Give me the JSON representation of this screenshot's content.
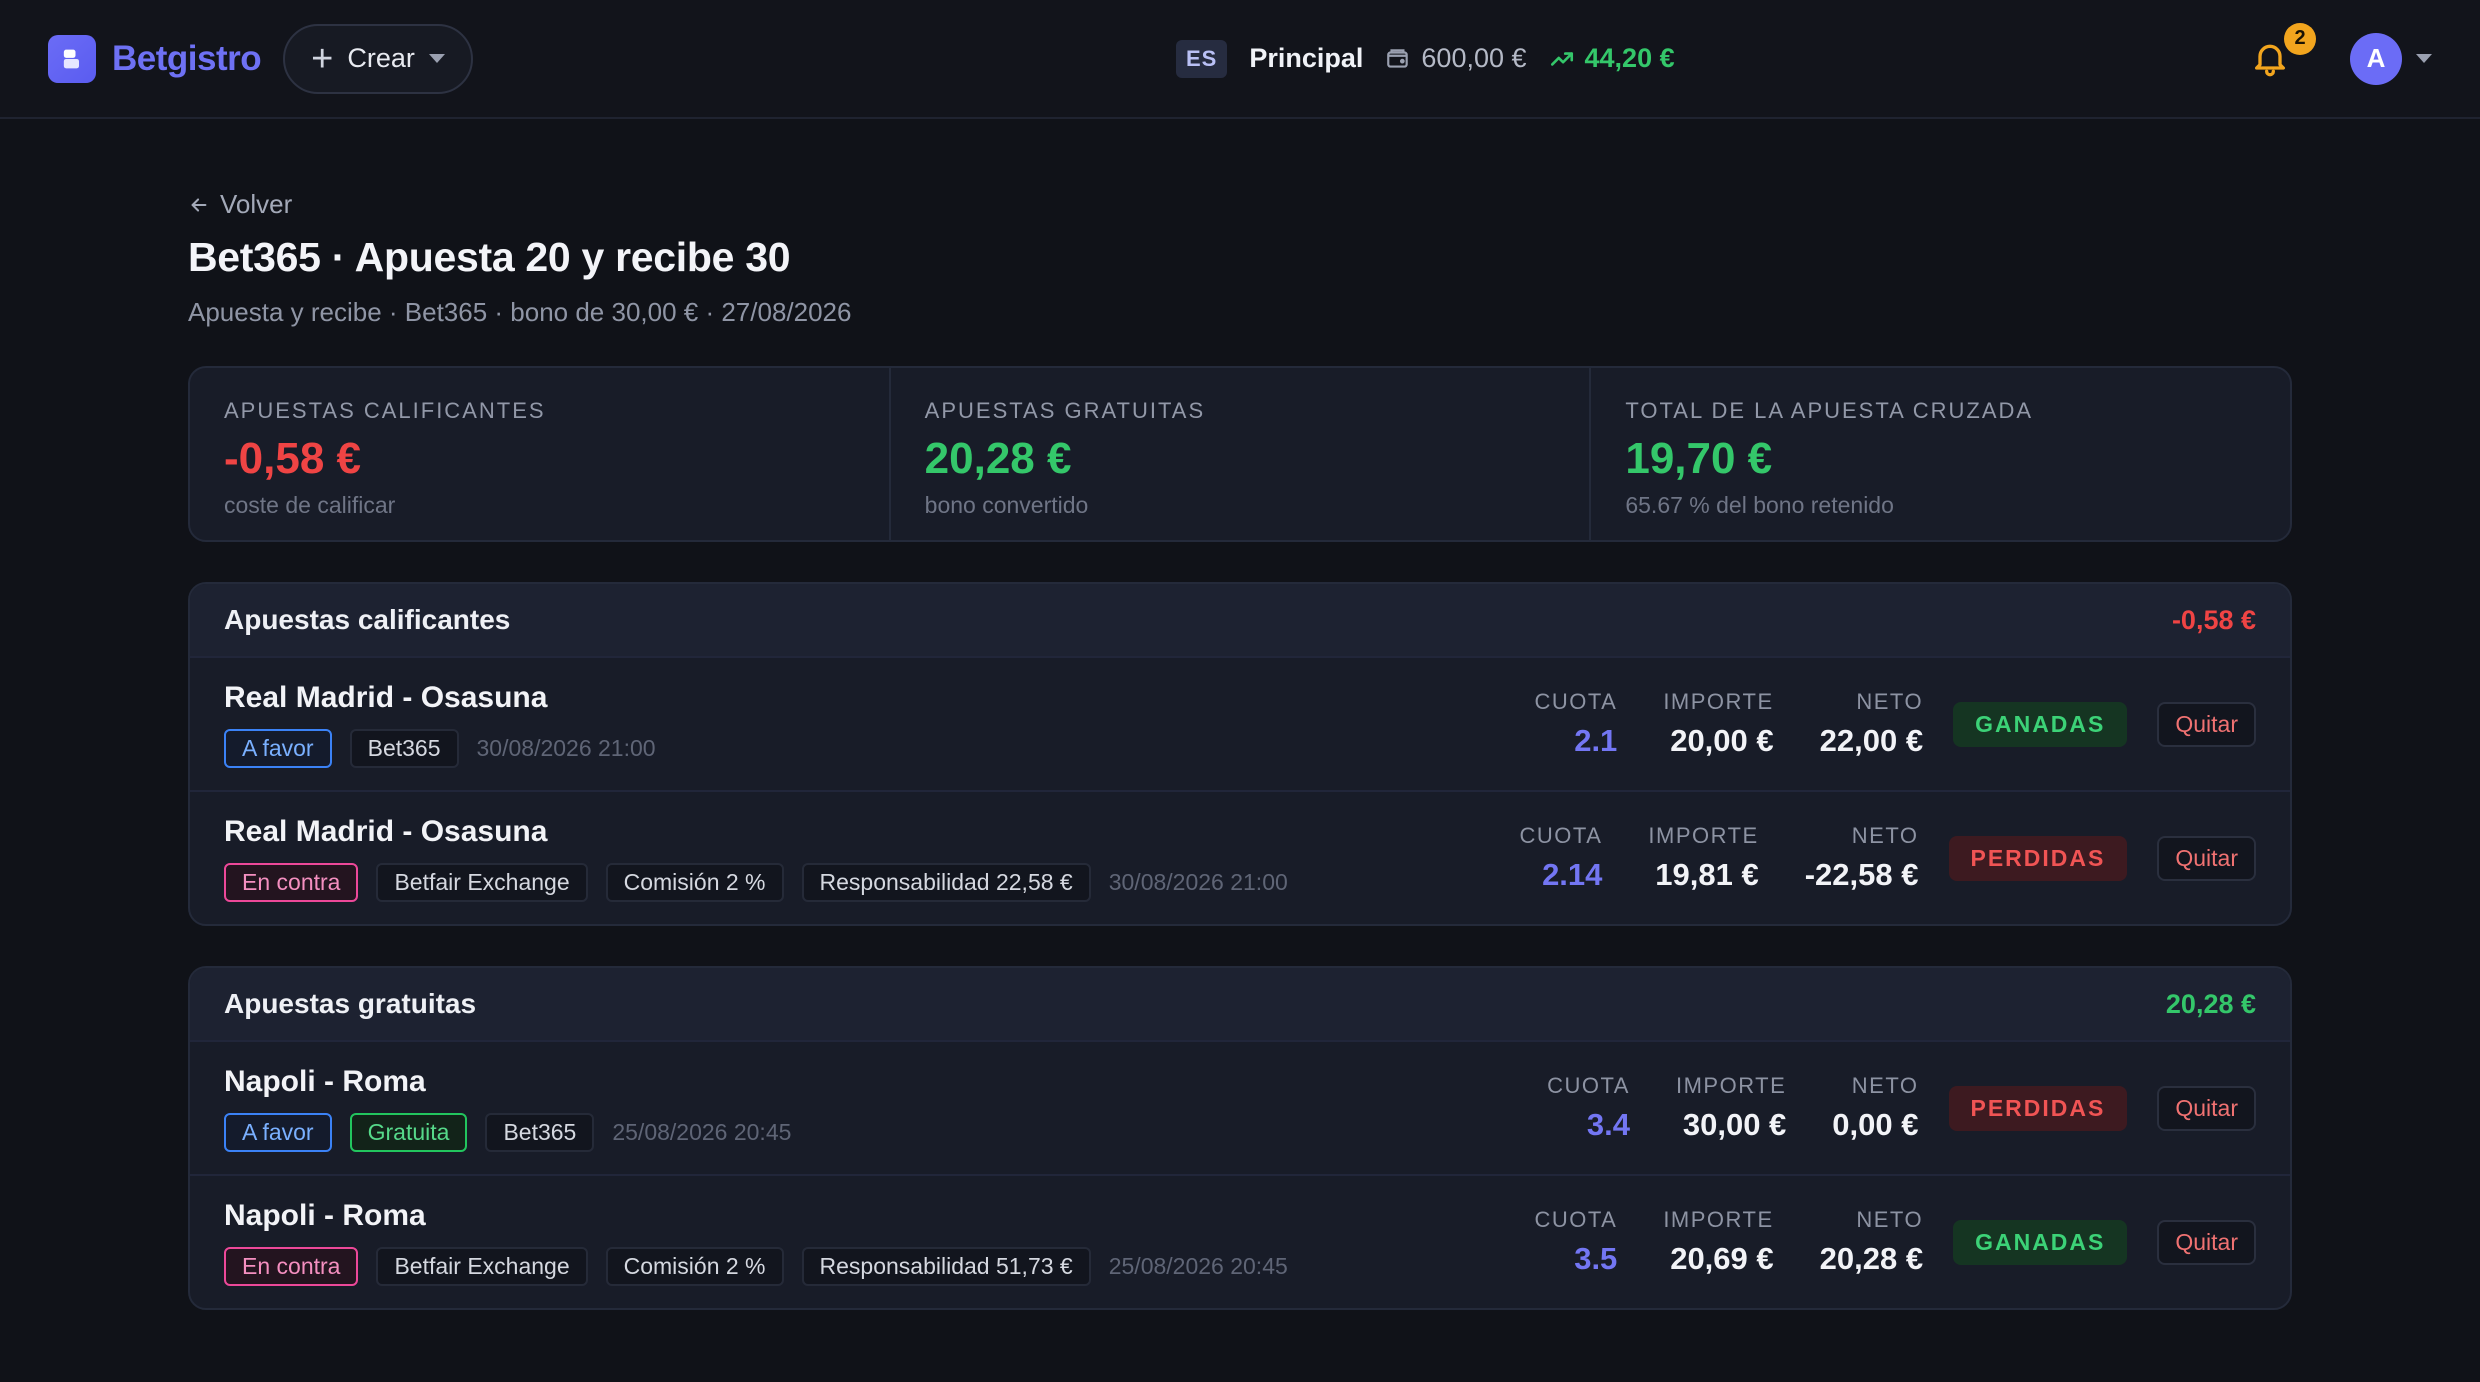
{
  "brand": {
    "name": "Betgistro"
  },
  "header": {
    "create_label": "Crear",
    "lang": "ES",
    "account": "Principal",
    "balance": "600,00 €",
    "profit": "44,20 €",
    "notifications": "2",
    "avatar_initial": "A"
  },
  "page": {
    "back_label": "Volver",
    "title": "Bet365 · Apuesta 20 y recibe 30",
    "subtitle": "Apuesta y recibe · Bet365 · bono de 30,00 € · 27/08/2026"
  },
  "stats": [
    {
      "label": "APUESTAS CALIFICANTES",
      "value": "-0,58 €",
      "sub": "coste de calificar"
    },
    {
      "label": "APUESTAS GRATUITAS",
      "value": "20,28 €",
      "sub": "bono convertido"
    },
    {
      "label": "TOTAL DE LA APUESTA CRUZADA",
      "value": "19,70 €",
      "sub": "65.67 % del bono retenido"
    }
  ],
  "labels": {
    "odds": "CUOTA",
    "stake": "IMPORTE",
    "net": "NETO",
    "remove": "Quitar"
  },
  "sections": [
    {
      "title": "Apuestas calificantes",
      "total": "-0,58 €",
      "rows": [
        {
          "match": "Real Madrid - Osasuna",
          "tags": [
            "A favor",
            "Bet365"
          ],
          "date": "30/08/2026 21:00",
          "odds": "2.1",
          "stake": "20,00 €",
          "net": "22,00 €",
          "status": "GANADAS"
        },
        {
          "match": "Real Madrid - Osasuna",
          "tags": [
            "En contra",
            "Betfair Exchange",
            "Comisión 2 %",
            "Responsabilidad 22,58 €"
          ],
          "date": "30/08/2026 21:00",
          "odds": "2.14",
          "stake": "19,81 €",
          "net": "-22,58 €",
          "status": "PERDIDAS"
        }
      ]
    },
    {
      "title": "Apuestas gratuitas",
      "total": "20,28 €",
      "rows": [
        {
          "match": "Napoli - Roma",
          "tags": [
            "A favor",
            "Gratuita",
            "Bet365"
          ],
          "date": "25/08/2026 20:45",
          "odds": "3.4",
          "stake": "30,00 €",
          "net": "0,00 €",
          "status": "PERDIDAS"
        },
        {
          "match": "Napoli - Roma",
          "tags": [
            "En contra",
            "Betfair Exchange",
            "Comisión 2 %",
            "Responsabilidad 51,73 €"
          ],
          "date": "25/08/2026 20:45",
          "odds": "3.5",
          "stake": "20,69 €",
          "net": "20,28 €",
          "status": "GANADAS"
        }
      ]
    }
  ],
  "colors": {
    "accent": "#6b6cf6",
    "positive": "#34c76a",
    "negative": "#ef4444",
    "warning": "#f2a51e"
  }
}
